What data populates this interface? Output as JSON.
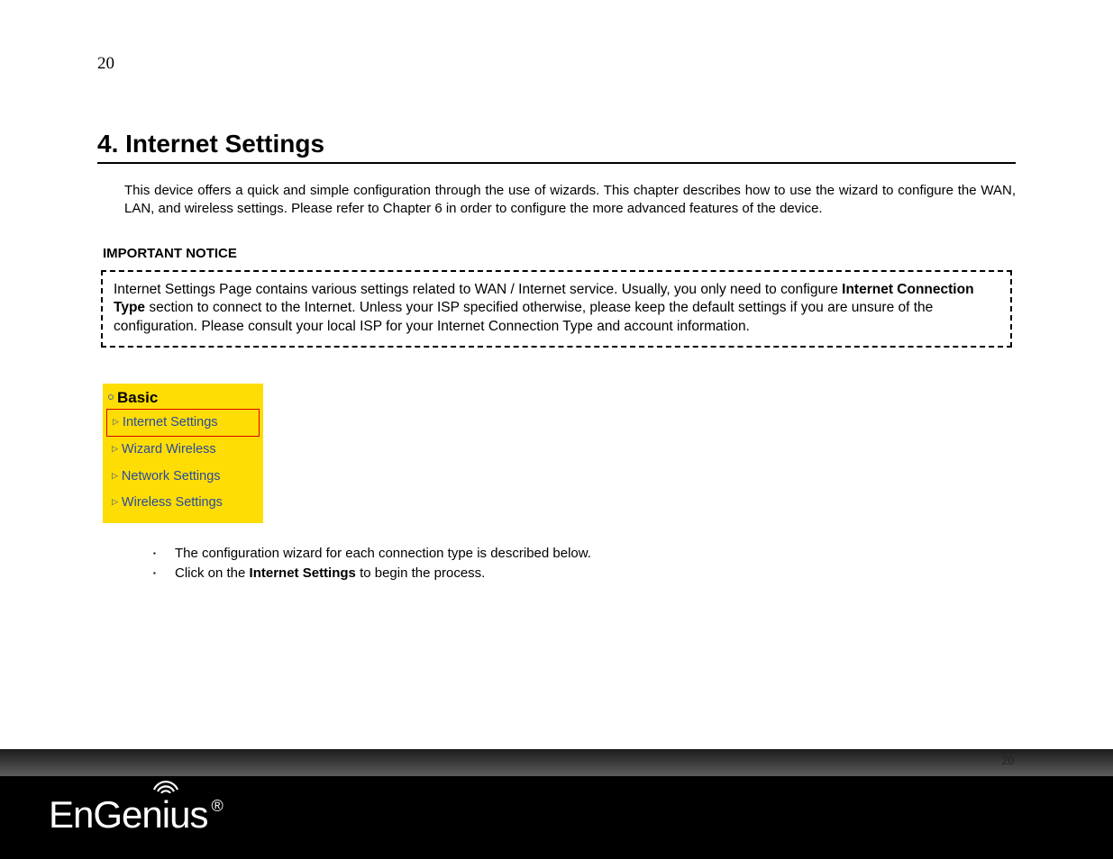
{
  "page_number_top": "20",
  "chapter_title": "4. Internet Settings",
  "intro_text": "This device offers a quick and simple configuration through the use of wizards. This chapter describes how to use the wizard to configure the WAN, LAN, and wireless settings. Please refer to Chapter 6 in order to configure the more advanced features of the device.",
  "notice_label": "IMPORTANT NOTICE",
  "notice": {
    "part1": "Internet Settings Page contains various settings related to WAN / Internet service. Usually, you only need to configure ",
    "bold1": "Internet Connection Type",
    "part2": " section to connect to the Internet. Unless your ISP specified otherwise, please keep the default settings if you are unsure of the configuration. Please consult your local ISP for your Internet Connection Type and account information."
  },
  "menu": {
    "header": "Basic",
    "items": [
      {
        "label": "Internet Settings",
        "selected": true
      },
      {
        "label": "Wizard Wireless",
        "selected": false
      },
      {
        "label": "Network Settings",
        "selected": false
      },
      {
        "label": "Wireless Settings",
        "selected": false
      }
    ]
  },
  "bullets": [
    {
      "text": "The configuration wizard for each connection type is described below."
    },
    {
      "pre": "Click on the ",
      "bold": "Internet Settings",
      "post": " to begin the process."
    }
  ],
  "footer_page_number": "20",
  "brand": "EnGenius",
  "registered_mark": "®"
}
